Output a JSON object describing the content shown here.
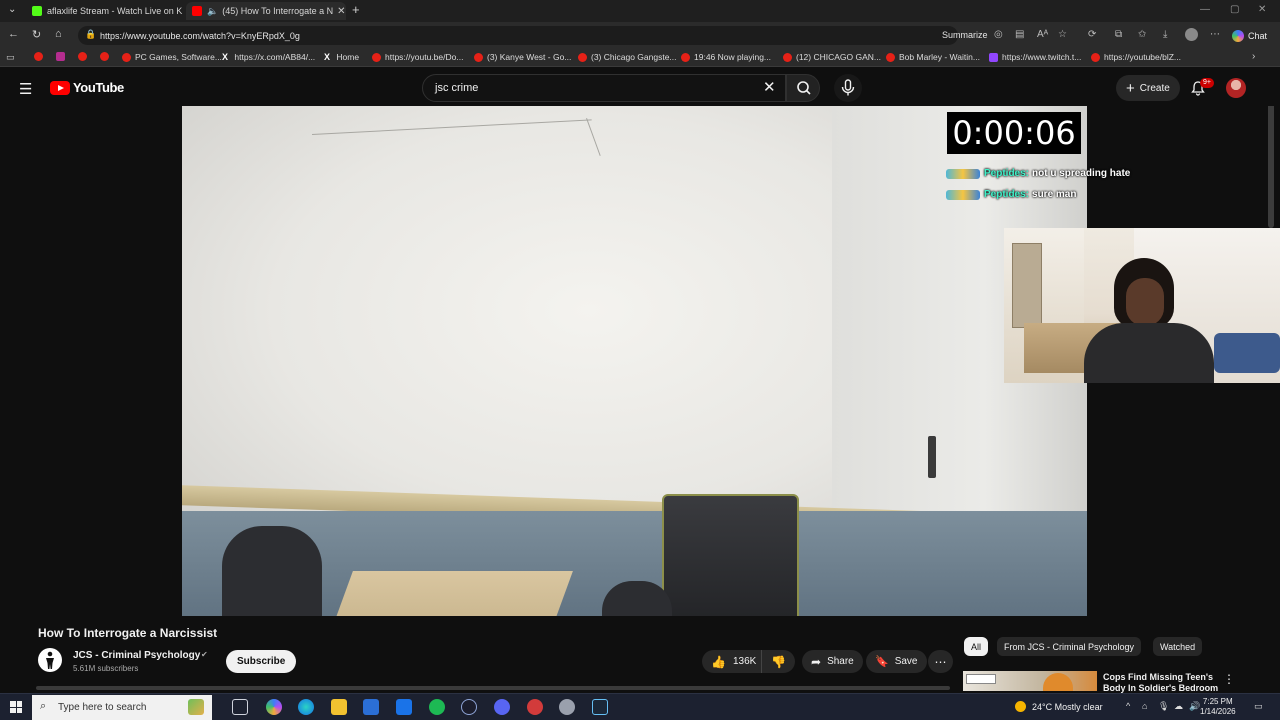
{
  "browser": {
    "tabs": [
      {
        "title": "aflaxlife Stream - Watch Live on K",
        "icon_color": "#53fc18",
        "active": false
      },
      {
        "title": "(45) How To Interrogate a N",
        "icon_color": "#ff0000",
        "active": true
      }
    ],
    "new_tab": "+",
    "url": "https://www.youtube.com/watch?v=KnyERpdX_0g",
    "summarize_label": "Summarize",
    "chat_label": "Chat",
    "bookmarks": [
      {
        "label": "",
        "icon": "youtube-icon"
      },
      {
        "label": "",
        "icon": "podcasts-icon"
      },
      {
        "label": "",
        "icon": "youtube-icon"
      },
      {
        "label": "",
        "icon": "youtube-icon"
      },
      {
        "label": "PC Games, Software...",
        "icon": "youtube-icon"
      },
      {
        "label": "https://x.com/AB84/...",
        "icon": "x-icon"
      },
      {
        "label": "Home",
        "icon": "x-icon"
      },
      {
        "label": "https://youtu.be/Do...",
        "icon": "youtube-icon"
      },
      {
        "label": "(3) Kanye West - Go...",
        "icon": "youtube-icon"
      },
      {
        "label": "(3) Chicago Gangste...",
        "icon": "youtube-icon"
      },
      {
        "label": "19:46 Now playing...",
        "icon": "youtube-icon"
      },
      {
        "label": "(12) CHICAGO GAN...",
        "icon": "youtube-icon"
      },
      {
        "label": "Bob Marley - Waitin...",
        "icon": "youtube-icon"
      },
      {
        "label": "https://www.twitch.t...",
        "icon": "twitch-icon"
      },
      {
        "label": "https://youtube/blZ...",
        "icon": "youtube-icon"
      }
    ]
  },
  "youtube": {
    "logo_text": "YouTube",
    "search_value": "jsc crime",
    "create_label": "Create",
    "notification_count": "9+",
    "overlay": {
      "timer": "0:00:06",
      "chat": [
        {
          "user": "Peptides:",
          "message": "not u spreading hate"
        },
        {
          "user": "Peptides:",
          "message": "sure man"
        }
      ]
    },
    "video_title": "How To Interrogate a Narcissist",
    "channel_name": "JCS - Criminal Psychology",
    "subscribers": "5.61M subscribers",
    "subscribe_label": "Subscribe",
    "likes": "136K",
    "share_label": "Share",
    "save_label": "Save",
    "chips": [
      "All",
      "From JCS - Criminal Psychology",
      "Watched"
    ],
    "recommended": {
      "title_line1": "Cops Find Missing Teen's",
      "title_line2": "Body In Soldier's Bedroom"
    }
  },
  "taskbar": {
    "search_placeholder": "Type here to search",
    "weather": "24°C  Mostly clear",
    "time": "7:25 PM",
    "date": "1/14/2026"
  },
  "colors": {
    "youtube_red": "#ff0000",
    "background": "#0f0f0f",
    "chat_user": "#3ef2c9"
  }
}
